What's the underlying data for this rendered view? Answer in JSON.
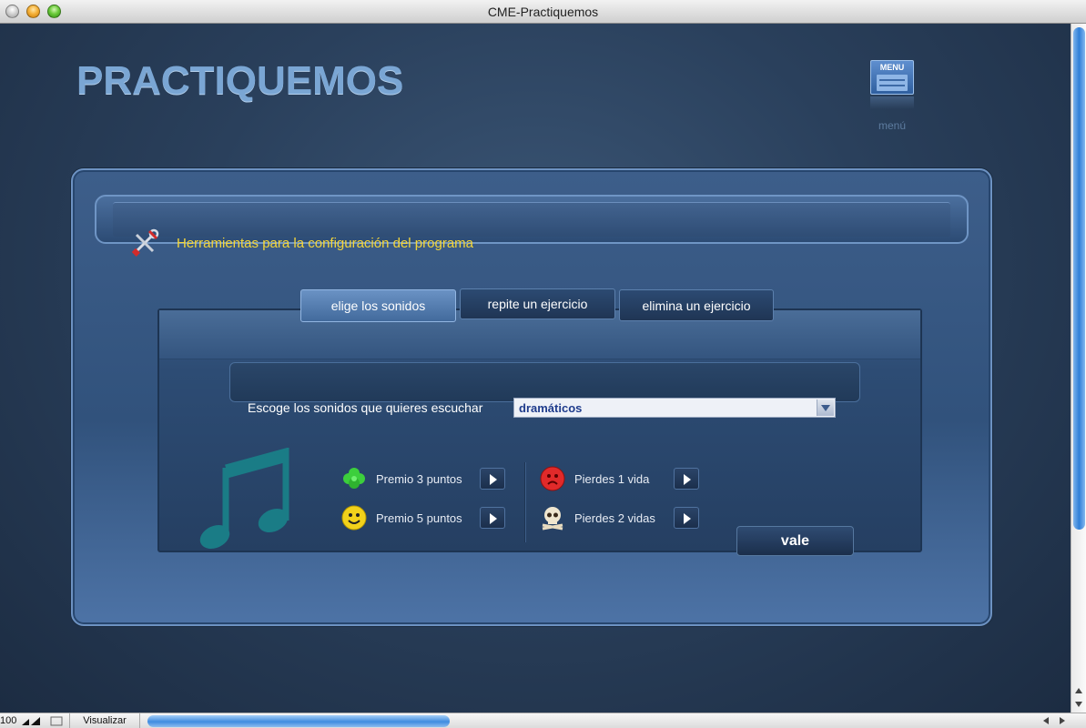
{
  "window": {
    "title": "CME-Practiquemos"
  },
  "app": {
    "logo_text": "PRACTIQUEMOS",
    "menu_button_label": "MENU",
    "menu_caption": "menú"
  },
  "header": {
    "title": "Herramientas para la configuración del programa"
  },
  "tabs": [
    {
      "label": "elige los sonidos",
      "active": true
    },
    {
      "label": "repite un ejercicio",
      "active": false
    },
    {
      "label": "elimina un ejercicio",
      "active": false
    }
  ],
  "sound_select": {
    "label": "Escoge los sonidos que quieres escuchar",
    "value": "dramáticos"
  },
  "sounds": [
    {
      "label": "Premio 3 puntos",
      "icon": "clover-icon"
    },
    {
      "label": "Premio 5 puntos",
      "icon": "smiley-icon"
    },
    {
      "label": "Pierdes 1 vida",
      "icon": "sad-face-icon"
    },
    {
      "label": "Pierdes 2 vidas",
      "icon": "skull-icon"
    }
  ],
  "actions": {
    "vale_label": "vale"
  },
  "statusbar": {
    "zoom": "100",
    "view_button": "Visualizar"
  },
  "colors": {
    "header_title": "#f5d73a",
    "select_value": "#1f3c8c",
    "note": "#1a7c86"
  }
}
